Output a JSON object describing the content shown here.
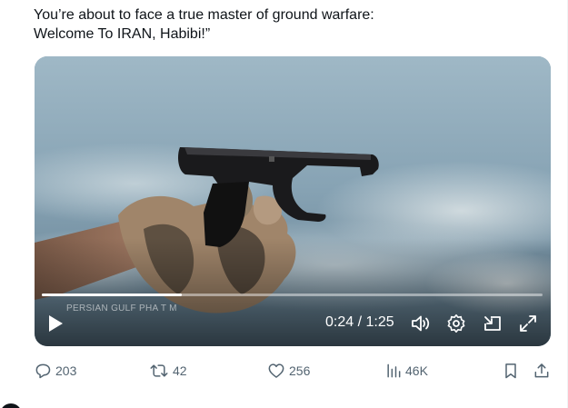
{
  "tweet": {
    "text_line1": "You’re about to face a true master of ground warfare:",
    "text_line2": "Welcome To IRAN, Habibi!”"
  },
  "video": {
    "overlay_watermark": "PERSIAN GULF PHA  T  M",
    "elapsed": "0:24",
    "duration": "1:25",
    "time_display": "0:24 / 1:25",
    "progress_fraction": 0.28,
    "controls": {
      "play": "play-icon",
      "volume": "volume-icon",
      "settings": "gear-icon",
      "pip": "picture-in-picture-icon",
      "fullscreen": "fullscreen-icon"
    }
  },
  "actions": {
    "replies": "203",
    "reposts": "42",
    "likes": "256",
    "views": "46K"
  },
  "colors": {
    "text_primary": "#0f1419",
    "text_secondary": "#536471",
    "divider": "#eff3f4"
  }
}
